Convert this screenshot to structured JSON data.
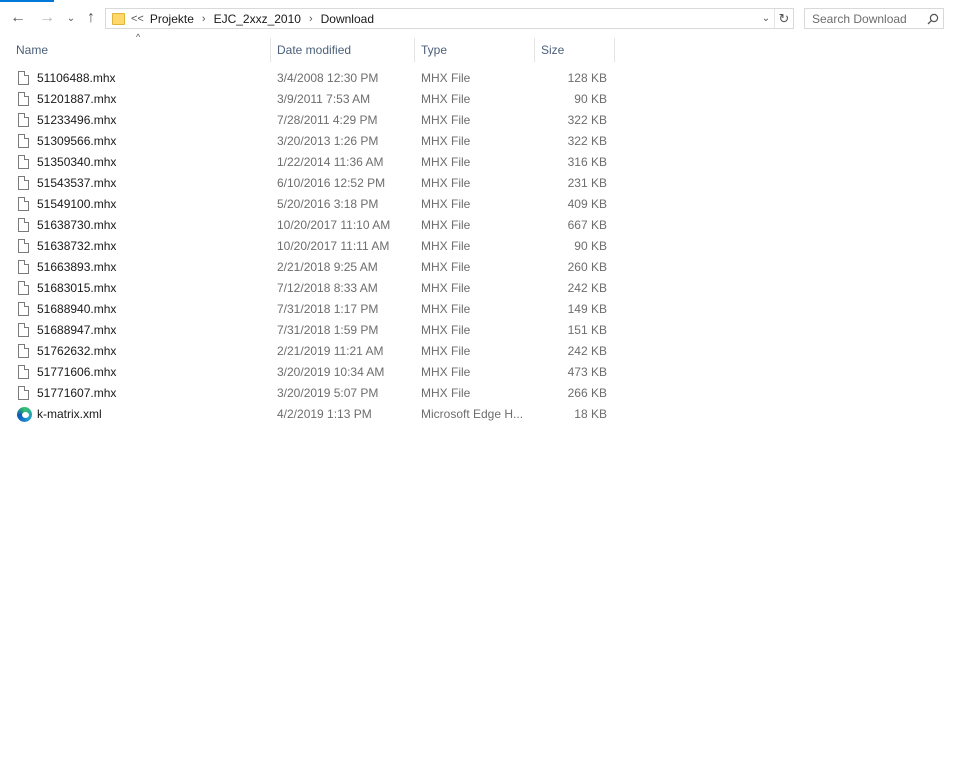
{
  "nav": {
    "back_icon": "arrow-left-icon",
    "forward_icon": "arrow-right-icon",
    "recent_icon": "chevron-down-icon",
    "up_icon": "arrow-up-icon"
  },
  "address": {
    "overflow": "<<",
    "crumbs": [
      "Projekte",
      "EJC_2xxz_2010",
      "Download"
    ]
  },
  "search": {
    "placeholder": "Search Download"
  },
  "columns": {
    "name": "Name",
    "date": "Date modified",
    "type": "Type",
    "size": "Size"
  },
  "colors": {
    "accent": "#0078d7",
    "header_text": "#4c607a"
  },
  "files": [
    {
      "name": "51106488.mhx",
      "date": "3/4/2008 12:30 PM",
      "type": "MHX File",
      "size": "128 KB",
      "icon": "document-icon"
    },
    {
      "name": "51201887.mhx",
      "date": "3/9/2011 7:53 AM",
      "type": "MHX File",
      "size": "90 KB",
      "icon": "document-icon"
    },
    {
      "name": "51233496.mhx",
      "date": "7/28/2011 4:29 PM",
      "type": "MHX File",
      "size": "322 KB",
      "icon": "document-icon"
    },
    {
      "name": "51309566.mhx",
      "date": "3/20/2013 1:26 PM",
      "type": "MHX File",
      "size": "322 KB",
      "icon": "document-icon"
    },
    {
      "name": "51350340.mhx",
      "date": "1/22/2014 11:36 AM",
      "type": "MHX File",
      "size": "316 KB",
      "icon": "document-icon"
    },
    {
      "name": "51543537.mhx",
      "date": "6/10/2016 12:52 PM",
      "type": "MHX File",
      "size": "231 KB",
      "icon": "document-icon"
    },
    {
      "name": "51549100.mhx",
      "date": "5/20/2016 3:18 PM",
      "type": "MHX File",
      "size": "409 KB",
      "icon": "document-icon"
    },
    {
      "name": "51638730.mhx",
      "date": "10/20/2017 11:10 AM",
      "type": "MHX File",
      "size": "667 KB",
      "icon": "document-icon"
    },
    {
      "name": "51638732.mhx",
      "date": "10/20/2017 11:11 AM",
      "type": "MHX File",
      "size": "90 KB",
      "icon": "document-icon"
    },
    {
      "name": "51663893.mhx",
      "date": "2/21/2018 9:25 AM",
      "type": "MHX File",
      "size": "260 KB",
      "icon": "document-icon"
    },
    {
      "name": "51683015.mhx",
      "date": "7/12/2018 8:33 AM",
      "type": "MHX File",
      "size": "242 KB",
      "icon": "document-icon"
    },
    {
      "name": "51688940.mhx",
      "date": "7/31/2018 1:17 PM",
      "type": "MHX File",
      "size": "149 KB",
      "icon": "document-icon"
    },
    {
      "name": "51688947.mhx",
      "date": "7/31/2018 1:59 PM",
      "type": "MHX File",
      "size": "151 KB",
      "icon": "document-icon"
    },
    {
      "name": "51762632.mhx",
      "date": "2/21/2019 11:21 AM",
      "type": "MHX File",
      "size": "242 KB",
      "icon": "document-icon"
    },
    {
      "name": "51771606.mhx",
      "date": "3/20/2019 10:34 AM",
      "type": "MHX File",
      "size": "473 KB",
      "icon": "document-icon"
    },
    {
      "name": "51771607.mhx",
      "date": "3/20/2019 5:07 PM",
      "type": "MHX File",
      "size": "266 KB",
      "icon": "document-icon"
    },
    {
      "name": "k-matrix.xml",
      "date": "4/2/2019 1:13 PM",
      "type": "Microsoft Edge H...",
      "size": "18 KB",
      "icon": "edge-icon"
    }
  ]
}
